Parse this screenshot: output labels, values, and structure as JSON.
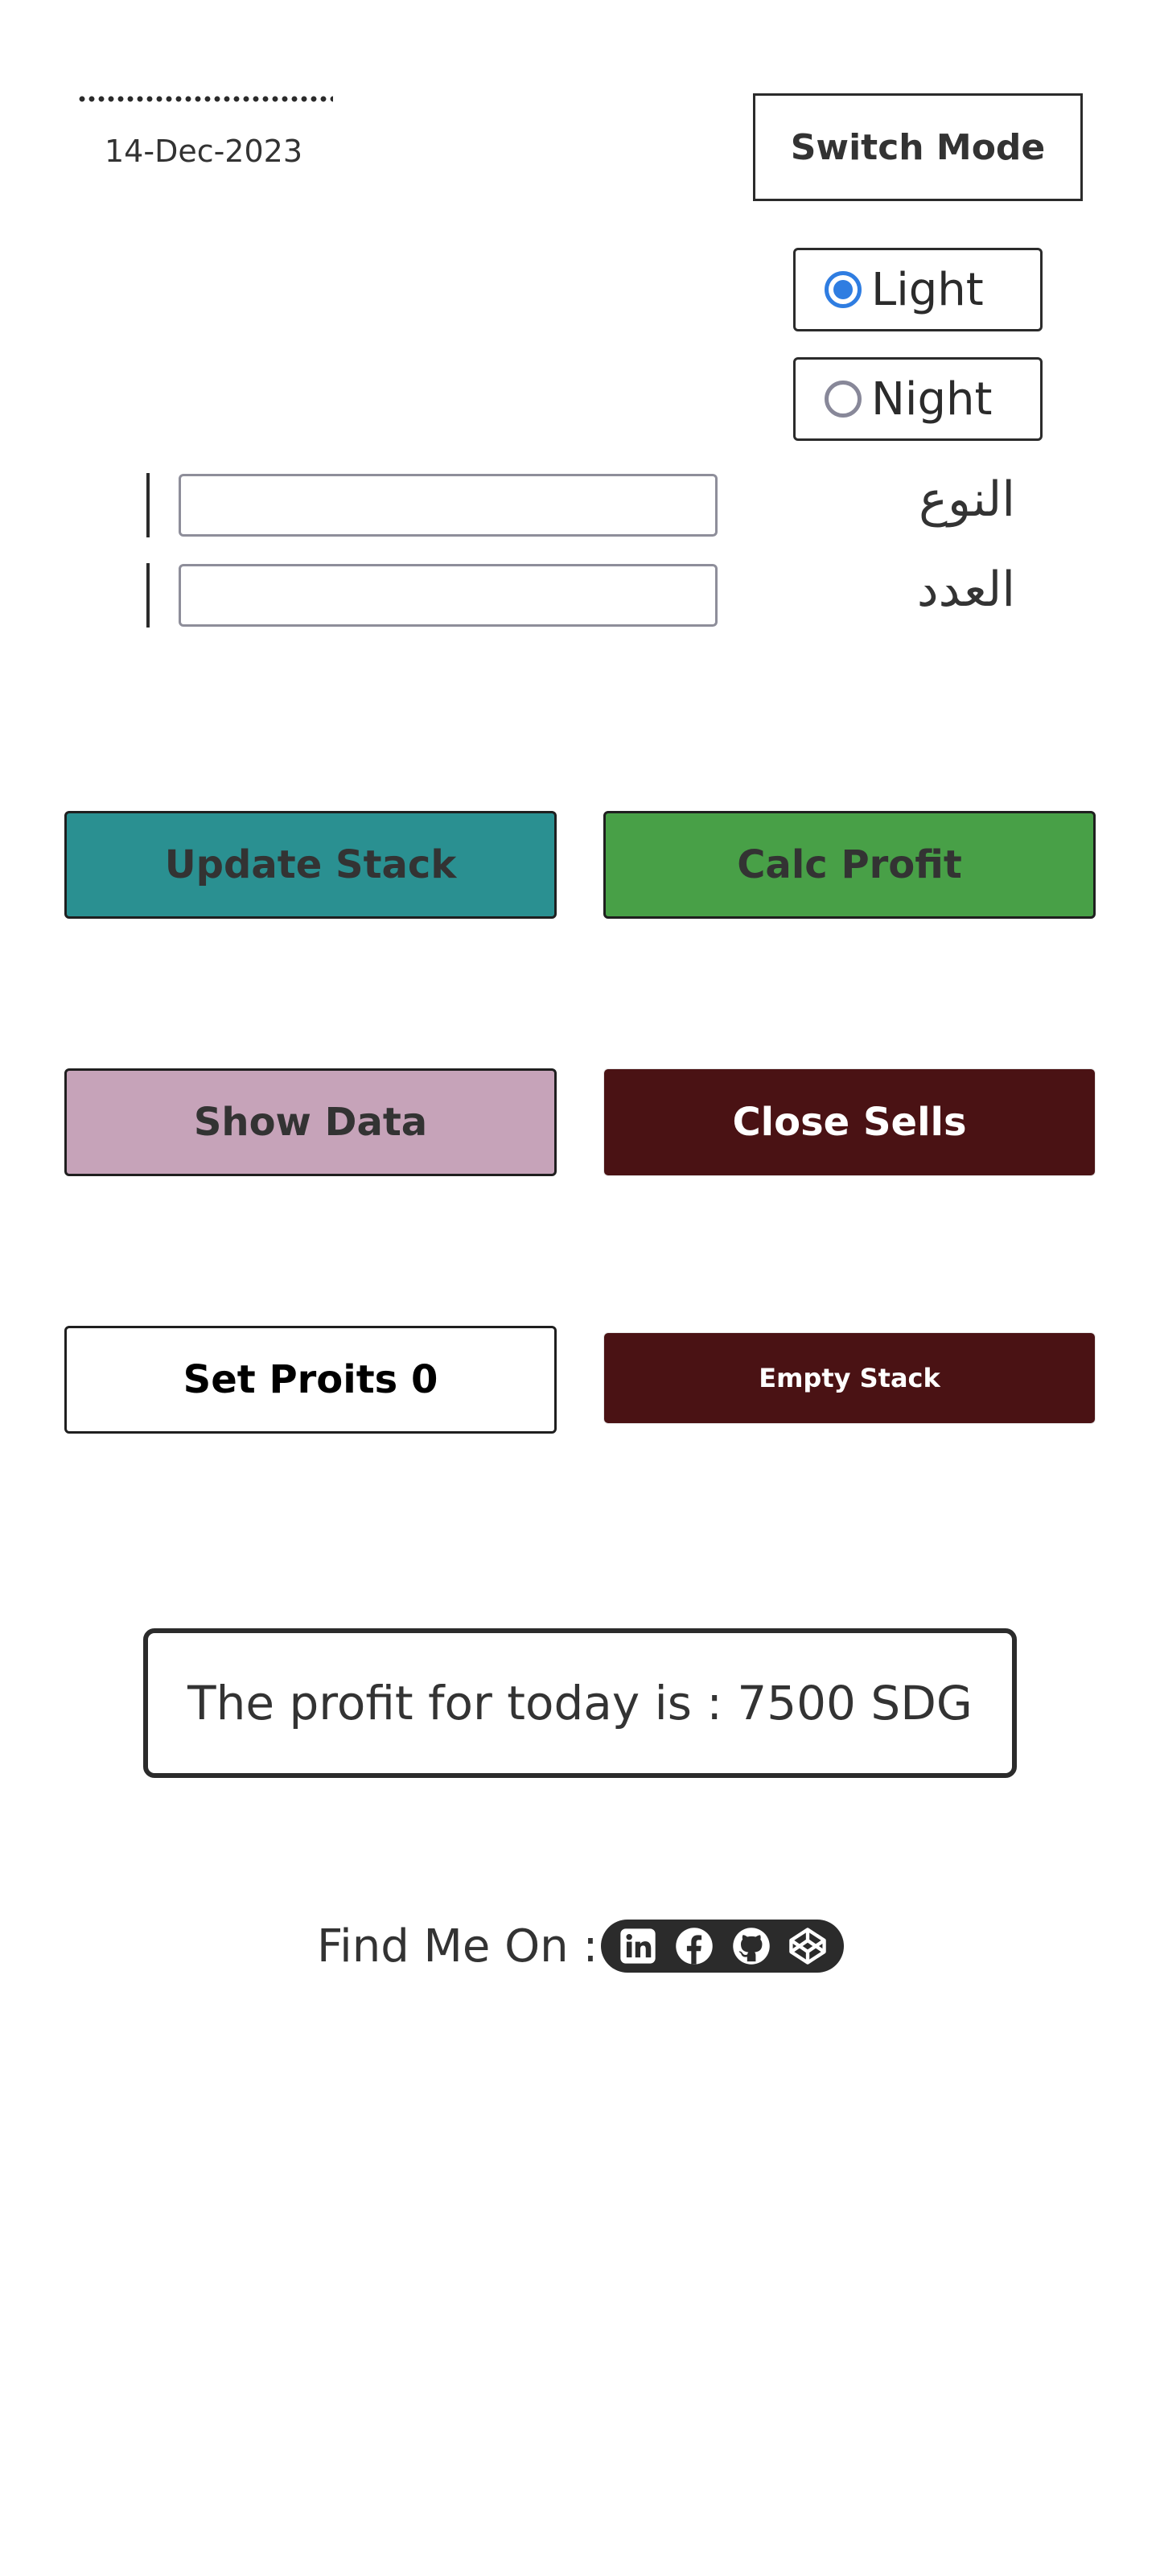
{
  "header": {
    "date": "14-Dec-2023",
    "switch_mode_label": "Switch Mode"
  },
  "theme": {
    "options": [
      {
        "label": "Light",
        "selected": true
      },
      {
        "label": "Night",
        "selected": false
      }
    ]
  },
  "form": {
    "type_label": "النوع",
    "type_value": "",
    "count_label": "العدد",
    "count_value": ""
  },
  "actions": {
    "update_stack": "Update Stack",
    "calc_profit": "Calc Profit",
    "show_data": "Show Data",
    "close_sells": "Close Sells",
    "set_profits": "Set Proits 0",
    "empty_stack": "Empty Stack"
  },
  "profit": {
    "text": "The profit for today is : 7500 SDG"
  },
  "footer": {
    "find_me_label": "Find Me On :",
    "social_icons": [
      "linkedin-icon",
      "facebook-icon",
      "github-icon",
      "codepen-icon"
    ]
  },
  "colors": {
    "teal": "#2a9091",
    "green": "#48a047",
    "mauve": "#c6a3b9",
    "maroon": "#4a1214",
    "radio_accent": "#2f7de1"
  }
}
